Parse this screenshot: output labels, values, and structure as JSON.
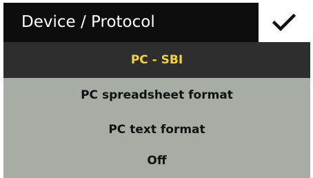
{
  "header": {
    "title": "Device / Protocol",
    "confirm_icon": "checkmark-icon"
  },
  "options": [
    {
      "label": "PC - SBI",
      "selected": true
    },
    {
      "label": "PC spreadsheet format",
      "selected": false
    },
    {
      "label": "PC text format",
      "selected": false
    },
    {
      "label": "Off",
      "selected": false
    }
  ],
  "colors": {
    "header_bg": "#0d0d0d",
    "header_text": "#ffffff",
    "selected_bg": "#2e2e2e",
    "selected_text": "#f2d634",
    "list_bg": "#a7ada5",
    "item_text": "#111111"
  }
}
